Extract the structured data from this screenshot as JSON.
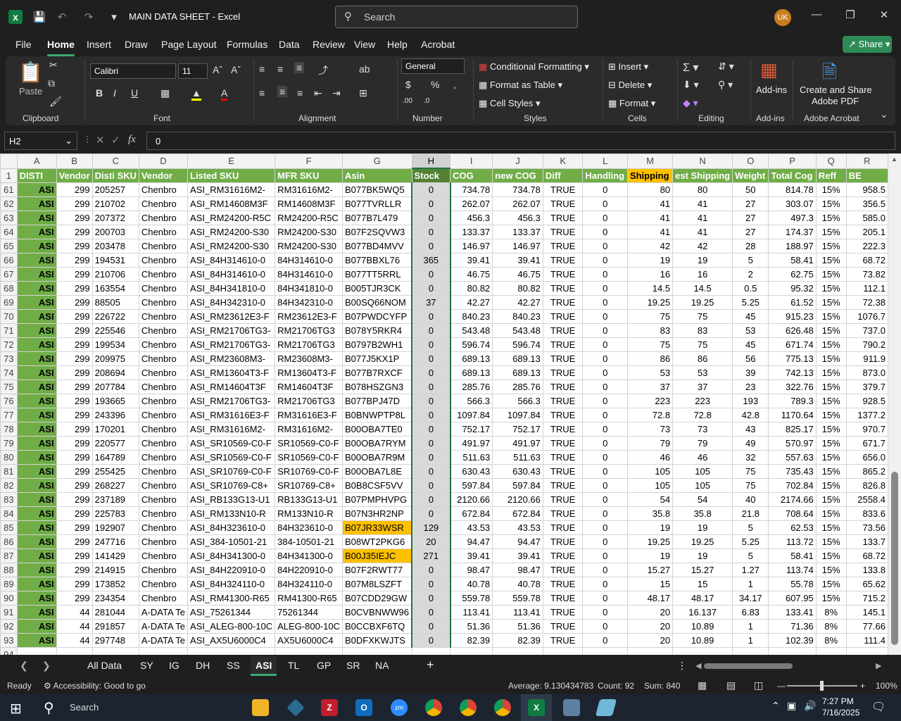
{
  "window": {
    "title": "MAIN DATA SHEET  -  Excel",
    "search_placeholder": "Search",
    "user_initials": "UK"
  },
  "menu": [
    "File",
    "Home",
    "Insert",
    "Draw",
    "Page Layout",
    "Formulas",
    "Data",
    "Review",
    "View",
    "Help",
    "Acrobat"
  ],
  "share_label": "Share",
  "ribbon": {
    "clipboard": {
      "paste": "Paste",
      "label": "Clipboard"
    },
    "font": {
      "name": "Calibri",
      "size": "11",
      "label": "Font"
    },
    "alignment": {
      "label": "Alignment"
    },
    "number": {
      "format": "General",
      "label": "Number"
    },
    "styles": {
      "conditional": "Conditional Formatting",
      "format_table": "Format as Table",
      "cell_styles": "Cell Styles",
      "label": "Styles"
    },
    "cells": {
      "insert": "Insert",
      "delete": "Delete",
      "format": "Format",
      "label": "Cells"
    },
    "editing": {
      "label": "Editing"
    },
    "addins": {
      "addins": "Add-ins",
      "label": "Add-ins"
    },
    "acrobat": {
      "create": "Create and Share",
      "pdf": "Adobe PDF",
      "label": "Adobe Acrobat"
    }
  },
  "formula_bar": {
    "name_box": "H2",
    "value": "0"
  },
  "columns": [
    "A",
    "B",
    "C",
    "D",
    "E",
    "F",
    "G",
    "H",
    "I",
    "J",
    "K",
    "L",
    "M",
    "N",
    "O",
    "P",
    "Q",
    "R"
  ],
  "headers": [
    "DISTI",
    "Vendor",
    "Disti SKU",
    "Vendor",
    "Listed SKU",
    "MFR SKU",
    "Asin",
    "Stock",
    "COG",
    "new COG",
    "Diff",
    "Handling",
    "Shipping",
    "est Shipping",
    "Weight",
    "Total Cog",
    "Reff",
    "BE"
  ],
  "rows": [
    [
      "61",
      "ASI",
      "299",
      "205257",
      "Chenbro",
      "ASI_RM31616M2-",
      "RM31616M2-",
      "B077BK5WQ5",
      "0",
      "734.78",
      "734.78",
      "TRUE",
      "0",
      "80",
      "80",
      "50",
      "814.78",
      "15%",
      "958.5"
    ],
    [
      "62",
      "ASI",
      "299",
      "210702",
      "Chenbro",
      "ASI_RM14608M3F",
      "RM14608M3F",
      "B077TVRLLR",
      "0",
      "262.07",
      "262.07",
      "TRUE",
      "0",
      "41",
      "41",
      "27",
      "303.07",
      "15%",
      "356.5"
    ],
    [
      "63",
      "ASI",
      "299",
      "207372",
      "Chenbro",
      "ASI_RM24200-R5C",
      "RM24200-R5C",
      "B077B7L479",
      "0",
      "456.3",
      "456.3",
      "TRUE",
      "0",
      "41",
      "41",
      "27",
      "497.3",
      "15%",
      "585.0"
    ],
    [
      "64",
      "ASI",
      "299",
      "200703",
      "Chenbro",
      "ASI_RM24200-S30",
      "RM24200-S30",
      "B07F2SQVW3",
      "0",
      "133.37",
      "133.37",
      "TRUE",
      "0",
      "41",
      "41",
      "27",
      "174.37",
      "15%",
      "205.1"
    ],
    [
      "65",
      "ASI",
      "299",
      "203478",
      "Chenbro",
      "ASI_RM24200-S30",
      "RM24200-S30",
      "B077BD4MVV",
      "0",
      "146.97",
      "146.97",
      "TRUE",
      "0",
      "42",
      "42",
      "28",
      "188.97",
      "15%",
      "222.3"
    ],
    [
      "66",
      "ASI",
      "299",
      "194531",
      "Chenbro",
      "ASI_84H314610-0",
      "84H314610-0",
      "B077BBXL76",
      "365",
      "39.41",
      "39.41",
      "TRUE",
      "0",
      "19",
      "19",
      "5",
      "58.41",
      "15%",
      "68.72"
    ],
    [
      "67",
      "ASI",
      "299",
      "210706",
      "Chenbro",
      "ASI_84H314610-0",
      "84H314610-0",
      "B077TT5RRL",
      "0",
      "46.75",
      "46.75",
      "TRUE",
      "0",
      "16",
      "16",
      "2",
      "62.75",
      "15%",
      "73.82"
    ],
    [
      "68",
      "ASI",
      "299",
      "163554",
      "Chenbro",
      "ASI_84H341810-0",
      "84H341810-0",
      "B005TJR3CK",
      "0",
      "80.82",
      "80.82",
      "TRUE",
      "0",
      "14.5",
      "14.5",
      "0.5",
      "95.32",
      "15%",
      "112.1"
    ],
    [
      "69",
      "ASI",
      "299",
      "88505",
      "Chenbro",
      "ASI_84H342310-0",
      "84H342310-0",
      "B00SQ66NOM",
      "37",
      "42.27",
      "42.27",
      "TRUE",
      "0",
      "19.25",
      "19.25",
      "5.25",
      "61.52",
      "15%",
      "72.38"
    ],
    [
      "70",
      "ASI",
      "299",
      "226722",
      "Chenbro",
      "ASI_RM23612E3-F",
      "RM23612E3-F",
      "B07PWDCYFP",
      "0",
      "840.23",
      "840.23",
      "TRUE",
      "0",
      "75",
      "75",
      "45",
      "915.23",
      "15%",
      "1076.7"
    ],
    [
      "71",
      "ASI",
      "299",
      "225546",
      "Chenbro",
      "ASI_RM21706TG3-",
      "RM21706TG3",
      "B078Y5RKR4",
      "0",
      "543.48",
      "543.48",
      "TRUE",
      "0",
      "83",
      "83",
      "53",
      "626.48",
      "15%",
      "737.0"
    ],
    [
      "72",
      "ASI",
      "299",
      "199534",
      "Chenbro",
      "ASI_RM21706TG3-",
      "RM21706TG3",
      "B0797B2WH1",
      "0",
      "596.74",
      "596.74",
      "TRUE",
      "0",
      "75",
      "75",
      "45",
      "671.74",
      "15%",
      "790.2"
    ],
    [
      "73",
      "ASI",
      "299",
      "209975",
      "Chenbro",
      "ASI_RM23608M3-",
      "RM23608M3-",
      "B077J5KX1P",
      "0",
      "689.13",
      "689.13",
      "TRUE",
      "0",
      "86",
      "86",
      "56",
      "775.13",
      "15%",
      "911.9"
    ],
    [
      "74",
      "ASI",
      "299",
      "208694",
      "Chenbro",
      "ASI_RM13604T3-F",
      "RM13604T3-F",
      "B077B7RXCF",
      "0",
      "689.13",
      "689.13",
      "TRUE",
      "0",
      "53",
      "53",
      "39",
      "742.13",
      "15%",
      "873.0"
    ],
    [
      "75",
      "ASI",
      "299",
      "207784",
      "Chenbro",
      "ASI_RM14604T3F",
      "RM14604T3F",
      "B078HSZGN3",
      "0",
      "285.76",
      "285.76",
      "TRUE",
      "0",
      "37",
      "37",
      "23",
      "322.76",
      "15%",
      "379.7"
    ],
    [
      "76",
      "ASI",
      "299",
      "193665",
      "Chenbro",
      "ASI_RM21706TG3-",
      "RM21706TG3",
      "B077BPJ47D",
      "0",
      "566.3",
      "566.3",
      "TRUE",
      "0",
      "223",
      "223",
      "193",
      "789.3",
      "15%",
      "928.5"
    ],
    [
      "77",
      "ASI",
      "299",
      "243396",
      "Chenbro",
      "ASI_RM31616E3-F",
      "RM31616E3-F",
      "B0BNWPTP8L",
      "0",
      "1097.84",
      "1097.84",
      "TRUE",
      "0",
      "72.8",
      "72.8",
      "42.8",
      "1170.64",
      "15%",
      "1377.2"
    ],
    [
      "78",
      "ASI",
      "299",
      "170201",
      "Chenbro",
      "ASI_RM31616M2-",
      "RM31616M2-",
      "B00OBA7TE0",
      "0",
      "752.17",
      "752.17",
      "TRUE",
      "0",
      "73",
      "73",
      "43",
      "825.17",
      "15%",
      "970.7"
    ],
    [
      "79",
      "ASI",
      "299",
      "220577",
      "Chenbro",
      "ASI_SR10569-C0-F",
      "SR10569-C0-F",
      "B00OBA7RYM",
      "0",
      "491.97",
      "491.97",
      "TRUE",
      "0",
      "79",
      "79",
      "49",
      "570.97",
      "15%",
      "671.7"
    ],
    [
      "80",
      "ASI",
      "299",
      "164789",
      "Chenbro",
      "ASI_SR10569-C0-F",
      "SR10569-C0-F",
      "B00OBA7R9M",
      "0",
      "511.63",
      "511.63",
      "TRUE",
      "0",
      "46",
      "46",
      "32",
      "557.63",
      "15%",
      "656.0"
    ],
    [
      "81",
      "ASI",
      "299",
      "255425",
      "Chenbro",
      "ASI_SR10769-C0-F",
      "SR10769-C0-F",
      "B00OBA7L8E",
      "0",
      "630.43",
      "630.43",
      "TRUE",
      "0",
      "105",
      "105",
      "75",
      "735.43",
      "15%",
      "865.2"
    ],
    [
      "82",
      "ASI",
      "299",
      "268227",
      "Chenbro",
      "ASI_SR10769-C8+",
      "SR10769-C8+",
      "B0B8CSF5VV",
      "0",
      "597.84",
      "597.84",
      "TRUE",
      "0",
      "105",
      "105",
      "75",
      "702.84",
      "15%",
      "826.8"
    ],
    [
      "83",
      "ASI",
      "299",
      "237189",
      "Chenbro",
      "ASI_RB133G13-U1",
      "RB133G13-U1",
      "B07PMPHVPG",
      "0",
      "2120.66",
      "2120.66",
      "TRUE",
      "0",
      "54",
      "54",
      "40",
      "2174.66",
      "15%",
      "2558.4"
    ],
    [
      "84",
      "ASI",
      "299",
      "225783",
      "Chenbro",
      "ASI_RM133N10-R",
      "RM133N10-R",
      "B07N3HR2NP",
      "0",
      "672.84",
      "672.84",
      "TRUE",
      "0",
      "35.8",
      "35.8",
      "21.8",
      "708.64",
      "15%",
      "833.6"
    ],
    [
      "85",
      "ASI",
      "299",
      "192907",
      "Chenbro",
      "ASI_84H323610-0",
      "84H323610-0",
      "B07JR33WSR",
      "129",
      "43.53",
      "43.53",
      "TRUE",
      "0",
      "19",
      "19",
      "5",
      "62.53",
      "15%",
      "73.56"
    ],
    [
      "86",
      "ASI",
      "299",
      "247716",
      "Chenbro",
      "ASI_384-10501-21",
      "384-10501-21",
      "B08WT2PKG6",
      "20",
      "94.47",
      "94.47",
      "TRUE",
      "0",
      "19.25",
      "19.25",
      "5.25",
      "113.72",
      "15%",
      "133.7"
    ],
    [
      "87",
      "ASI",
      "299",
      "141429",
      "Chenbro",
      "ASI_84H341300-0",
      "84H341300-0",
      "B00J35IEJC",
      "271",
      "39.41",
      "39.41",
      "TRUE",
      "0",
      "19",
      "19",
      "5",
      "58.41",
      "15%",
      "68.72"
    ],
    [
      "88",
      "ASI",
      "299",
      "214915",
      "Chenbro",
      "ASI_84H220910-0",
      "84H220910-0",
      "B07F2RWT77",
      "0",
      "98.47",
      "98.47",
      "TRUE",
      "0",
      "15.27",
      "15.27",
      "1.27",
      "113.74",
      "15%",
      "133.8"
    ],
    [
      "89",
      "ASI",
      "299",
      "173852",
      "Chenbro",
      "ASI_84H324110-0",
      "84H324110-0",
      "B07M8LSZFT",
      "0",
      "40.78",
      "40.78",
      "TRUE",
      "0",
      "15",
      "15",
      "1",
      "55.78",
      "15%",
      "65.62"
    ],
    [
      "90",
      "ASI",
      "299",
      "234354",
      "Chenbro",
      "ASI_RM41300-R65",
      "RM41300-R65",
      "B07CDD29GW",
      "0",
      "559.78",
      "559.78",
      "TRUE",
      "0",
      "48.17",
      "48.17",
      "34.17",
      "607.95",
      "15%",
      "715.2"
    ],
    [
      "91",
      "ASI",
      "44",
      "281044",
      "A-DATA Te",
      "ASI_75261344",
      "75261344",
      "B0CVBNWW96",
      "0",
      "113.41",
      "113.41",
      "TRUE",
      "0",
      "20",
      "16.137",
      "6.83",
      "133.41",
      "8%",
      "145.1"
    ],
    [
      "92",
      "ASI",
      "44",
      "291857",
      "A-DATA Te",
      "ASI_ALEG-800-10C",
      "ALEG-800-10C",
      "B0CCBXF6TQ",
      "0",
      "51.36",
      "51.36",
      "TRUE",
      "0",
      "20",
      "10.89",
      "1",
      "71.36",
      "8%",
      "77.66"
    ],
    [
      "93",
      "ASI",
      "44",
      "297748",
      "A-DATA Te",
      "ASI_AX5U6000C4",
      "AX5U6000C4",
      "B0DFXKWJTS",
      "0",
      "82.39",
      "82.39",
      "TRUE",
      "0",
      "20",
      "10.89",
      "1",
      "102.39",
      "8%",
      "111.4"
    ],
    [
      "94",
      "",
      "",
      "",
      "",
      "",
      "",
      "",
      "",
      "",
      "",
      "",
      "",
      "",
      "",
      "",
      "",
      "",
      ""
    ]
  ],
  "highlighted_asins": [
    "85",
    "87"
  ],
  "sheets": [
    "All Data",
    "SY",
    "IG",
    "DH",
    "SS",
    "ASI",
    "TL",
    "GP",
    "SR",
    "NA"
  ],
  "active_sheet": "ASI",
  "status": {
    "ready": "Ready",
    "accessibility": "Accessibility: Good to go",
    "average": "Average: 9.130434783",
    "count": "Count: 92",
    "sum": "Sum: 840",
    "zoom": "100%"
  },
  "taskbar": {
    "search": "Search",
    "time": "7:27 PM",
    "date": "7/16/2025"
  },
  "colors": {
    "excel_green": "#217346",
    "header_green": "#70ad47",
    "shipping_yellow": "#ffc000"
  }
}
